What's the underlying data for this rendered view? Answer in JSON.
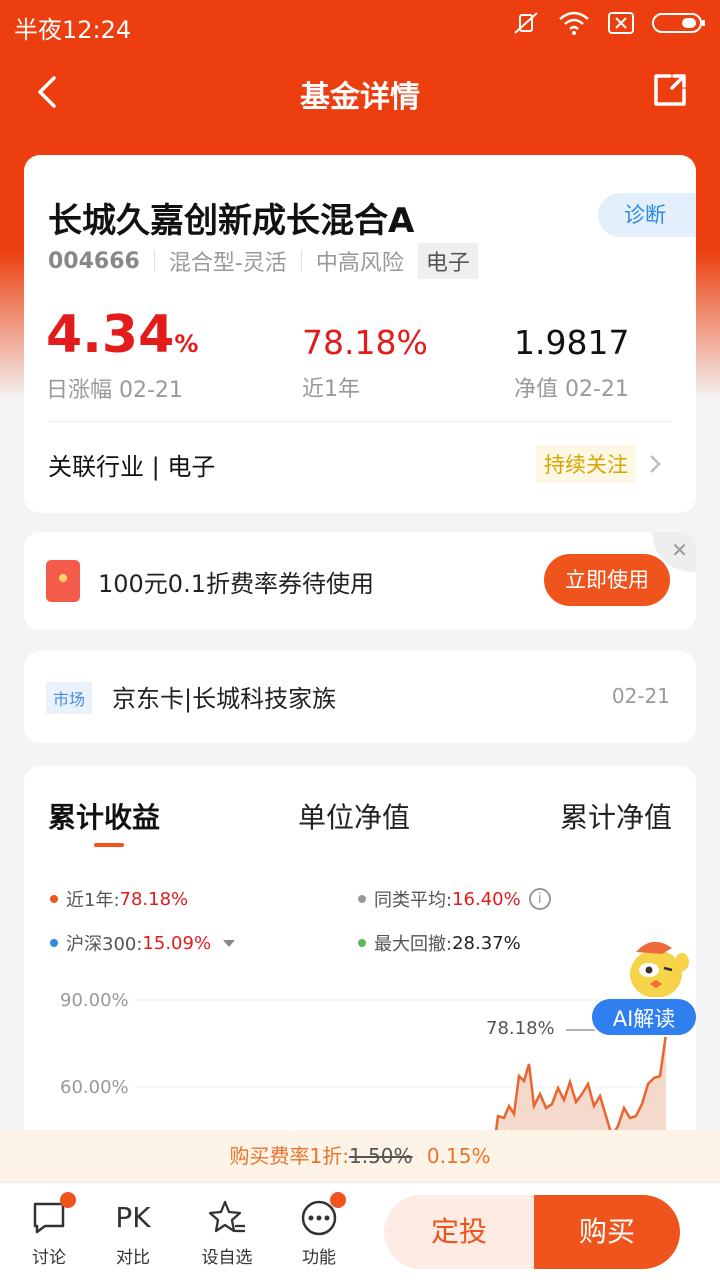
{
  "status": {
    "time": "半夜12:24"
  },
  "nav": {
    "title": "基金详情"
  },
  "fund": {
    "name": "长城久嘉创新成长混合A",
    "diagnose": "诊断",
    "code": "004666",
    "type": "混合型-灵活",
    "risk": "中高风险",
    "sector_tag": "电子",
    "daily_change": "4.34",
    "daily_change_unit": "%",
    "daily_label": "日涨幅 02-21",
    "year_return": "78.18%",
    "year_label": "近1年",
    "nav_value": "1.9817",
    "nav_label": "净值 02-21",
    "industry": "关联行业 | 电子",
    "follow": "持续关注"
  },
  "coupon": {
    "text": "100元0.1折费率券待使用",
    "button": "立即使用"
  },
  "news": {
    "tag": "市场",
    "text": "京东卡|长城科技家族",
    "date": "02-21"
  },
  "chart_tabs": [
    "累计收益",
    "单位净值",
    "累计净值"
  ],
  "legend": {
    "year_label": "近1年:",
    "year_value": "78.18%",
    "avg_label": "同类平均:",
    "avg_value": "16.40%",
    "hs300_label": "沪深300:",
    "hs300_value": "15.09%",
    "dd_label": "最大回撤:",
    "dd_value": "28.37%"
  },
  "chart_data": {
    "type": "area",
    "y_ticks": [
      "90.00%",
      "60.00%"
    ],
    "annotation": "78.18%",
    "series": [
      {
        "name": "近1年",
        "end_value": 78.18
      }
    ],
    "colors": {
      "fund": "#e8662e",
      "avg": "#999999",
      "hs300": "#2d8ae6",
      "drawdown": "#5cb85c"
    }
  },
  "ai": {
    "label": "AI解读"
  },
  "promo": {
    "prefix": "购买费率1折:",
    "old": "1.50%",
    "new": "0.15%"
  },
  "bottom": {
    "discuss": "讨论",
    "pk_icon": "PK",
    "compare": "对比",
    "watch": "设自选",
    "func": "功能",
    "dingtou": "定投",
    "buy": "购买"
  }
}
